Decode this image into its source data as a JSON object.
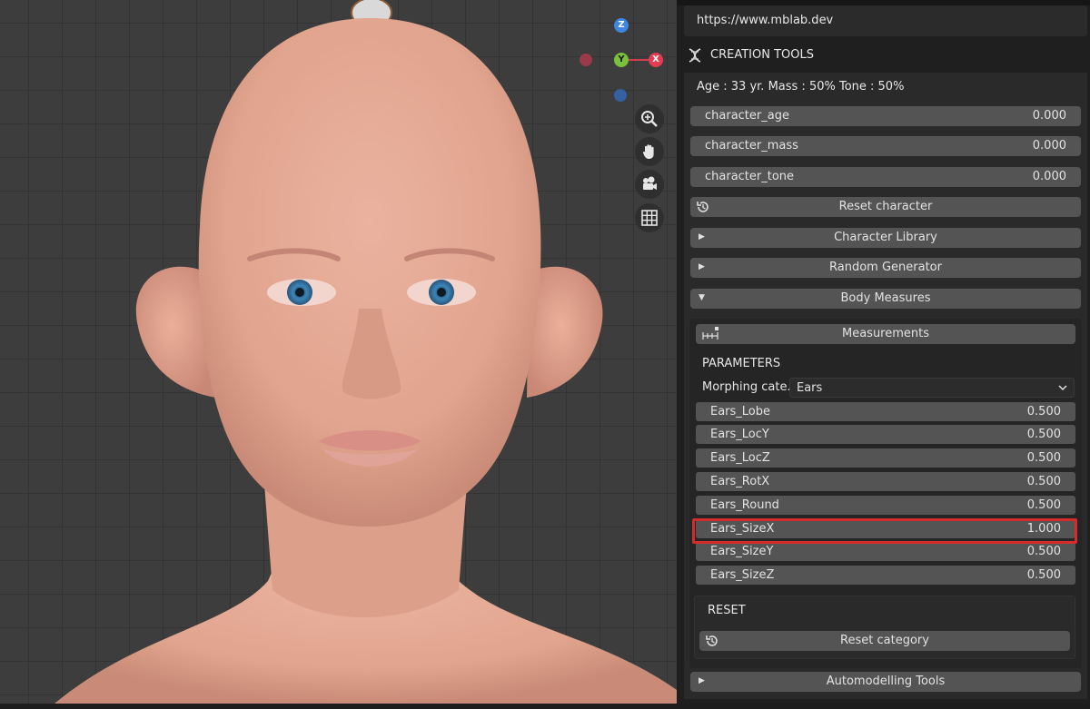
{
  "viewport": {
    "gizmo": {
      "z_label": "Z",
      "y_label": "Y",
      "x_label": "X"
    },
    "nav_icons": [
      "zoom-icon",
      "hand-pan-icon",
      "camera-icon",
      "grid-icon"
    ]
  },
  "panel": {
    "url": "https://www.mblab.dev",
    "title": "CREATION TOOLS",
    "info": "Age : 33 yr.  Mass : 50%  Tone : 50%",
    "character_sliders": [
      {
        "label": "character_age",
        "value": "0.000"
      },
      {
        "label": "character_mass",
        "value": "0.000"
      },
      {
        "label": "character_tone",
        "value": "0.000"
      }
    ],
    "reset_character": "Reset character",
    "collapsibles": {
      "library": "Character Library",
      "random": "Random Generator",
      "body_measures": "Body Measures",
      "automodelling": "Automodelling Tools"
    },
    "measurements_button": "Measurements",
    "parameters_heading": "PARAMETERS",
    "morphing_label": "Morphing cate..",
    "morphing_value": "Ears",
    "params": [
      {
        "label": "Ears_Lobe",
        "value": "0.500"
      },
      {
        "label": "Ears_LocY",
        "value": "0.500"
      },
      {
        "label": "Ears_LocZ",
        "value": "0.500"
      },
      {
        "label": "Ears_RotX",
        "value": "0.500"
      },
      {
        "label": "Ears_Round",
        "value": "0.500"
      },
      {
        "label": "Ears_SizeX",
        "value": "1.000"
      },
      {
        "label": "Ears_SizeY",
        "value": "0.500"
      },
      {
        "label": "Ears_SizeZ",
        "value": "0.500"
      }
    ],
    "reset_heading": "RESET",
    "reset_category": "Reset category"
  },
  "colors": {
    "highlight": "#d62b2b",
    "slider_bg": "#545454",
    "panel_bg": "#2a2a2a",
    "skin": "#e2a48e"
  }
}
